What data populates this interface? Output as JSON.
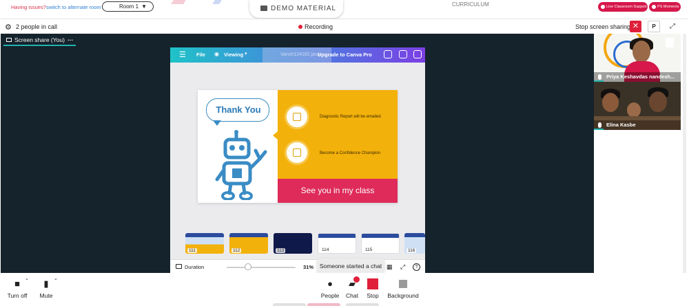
{
  "topbar": {
    "issues_text": "Having issues?",
    "alternate_room_link": "switch to alternate room",
    "room_selected": "Room 1",
    "demo_tab_label": "DEMO MATERIAL",
    "curriculum_label": "CURRICULUM",
    "live_support_label": "Live Classroom Support",
    "ps_moments_label": "PS Moments"
  },
  "callbar": {
    "people_count_text": "2 people in call",
    "recording_text": "Recording",
    "stop_sharing_label": "Stop screen sharing",
    "close_icon": "close-icon",
    "p_label": "P",
    "expand_icon": "expand-icon"
  },
  "stage": {
    "tab_label": "Screen share (You)"
  },
  "canva": {
    "file_label": "File",
    "viewing_label": "Viewing",
    "watermark": "Vansh124182.java",
    "upgrade_label": "Upgrade to Canva Pro"
  },
  "slide": {
    "thank_you": "Thank You",
    "info1": "Diagnostic Report will be emailed",
    "info2": "Become a Confidence Champion",
    "cta": "See you in my class"
  },
  "thumbnails": [
    "111",
    "112",
    "113",
    "114",
    "115",
    "116"
  ],
  "controls": {
    "duration_label": "Duration",
    "zoom_percent": "31%",
    "zoom_fraction": 0.31
  },
  "toast": {
    "message": "Someone started a chat"
  },
  "participants": [
    {
      "name": "Priya Keshavdas nandesh..."
    },
    {
      "name": "Elina Kasbe"
    }
  ],
  "bottombar": {
    "camera_label": "Turn off",
    "mute_label": "Mute",
    "people_label": "People",
    "chat_label": "Chat",
    "stop_label": "Stop",
    "background_label": "Background"
  },
  "colors": {
    "accent_red": "#e0203a",
    "brand_pink": "#d6184b",
    "teal": "#1fb5b0",
    "slide_yellow": "#f3b10b",
    "slide_cta": "#de2b5a",
    "stage_bg": "#15232c"
  }
}
